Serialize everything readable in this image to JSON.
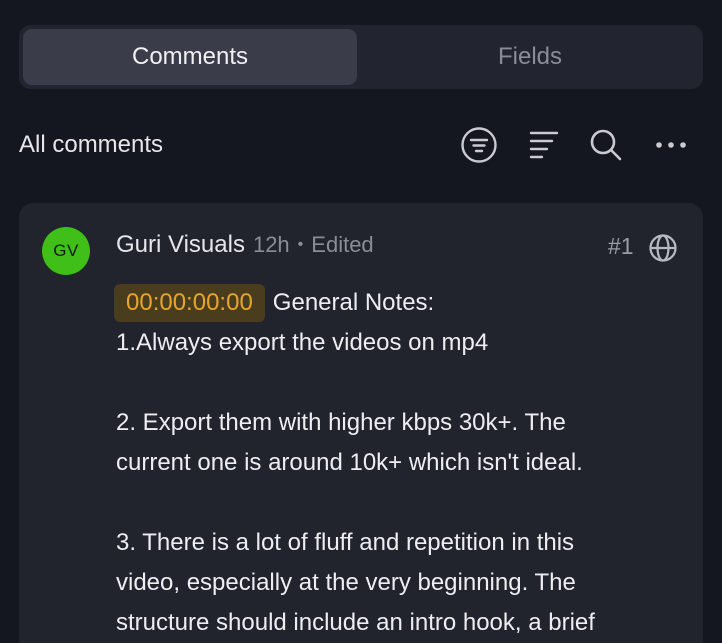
{
  "tabs": [
    {
      "label": "Comments"
    },
    {
      "label": "Fields"
    }
  ],
  "header": {
    "title": "All comments",
    "icons": [
      "filter-circle-icon",
      "sort-lines-icon",
      "search-icon",
      "more-dots-icon"
    ]
  },
  "comment": {
    "avatar_initials": "GV",
    "author": "Guri Visuals",
    "time": "12h",
    "separator": "•",
    "edited": "Edited",
    "number": "#1",
    "visibility_icon": "globe-icon",
    "timestamp": "00:00:00:00",
    "lines": [
      "General Notes:",
      "1.Always export the videos on mp4",
      "",
      "2. Export them with higher kbps 30k+. The",
      "current one is around 10k+ which isn't ideal.",
      "",
      "3. There is a lot of fluff and repetition in this",
      "video, especially at the very beginning. The",
      "structure should include an intro hook, a brief"
    ]
  },
  "colors": {
    "background": "#151720",
    "card": "#21232d",
    "tab_active": "#3a3d49",
    "avatar": "#3fbf17",
    "timestamp_bg": "#4a3d1e",
    "timestamp_text": "#e8a52b"
  }
}
